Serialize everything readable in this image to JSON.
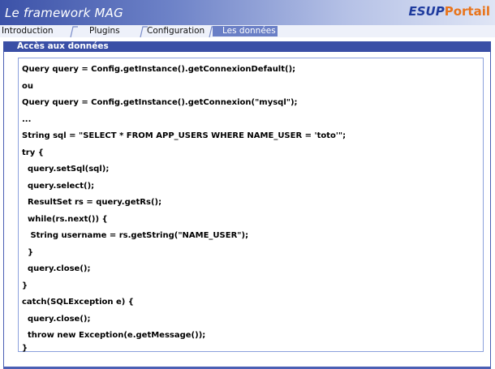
{
  "header": {
    "title": "Le framework MAG",
    "logo_part1": "ESUP",
    "logo_part2": "Portail"
  },
  "tabs": [
    {
      "label": "Introduction",
      "active": false
    },
    {
      "label": "Plugins",
      "active": false
    },
    {
      "label": "Configuration",
      "active": false
    },
    {
      "label": "Les données",
      "active": true
    }
  ],
  "section": {
    "title": "Accès aux données"
  },
  "code_lines": [
    "Query query = Config.getInstance().getConnexionDefault();",
    "ou",
    "Query query = Config.getInstance().getConnexion(\"mysql\");",
    "...",
    "String sql = \"SELECT * FROM APP_USERS WHERE NAME_USER = 'toto'\";",
    "try {",
    "  query.setSql(sql);",
    "  query.select();",
    "  ResultSet rs = query.getRs();",
    "  while(rs.next()) {",
    "   String username = rs.getString(\"NAME_USER\");",
    "  }",
    "  query.close();",
    "}",
    "catch(SQLException e) {",
    "  query.close();",
    "  throw new Exception(e.getMessage());",
    "}"
  ],
  "colors": {
    "header_blue": "#3c52a8",
    "active_tab": "#6a7fc6",
    "section_bar": "#3a4fa6",
    "logo_blue": "#1f3b9e",
    "logo_orange": "#e8741c"
  }
}
